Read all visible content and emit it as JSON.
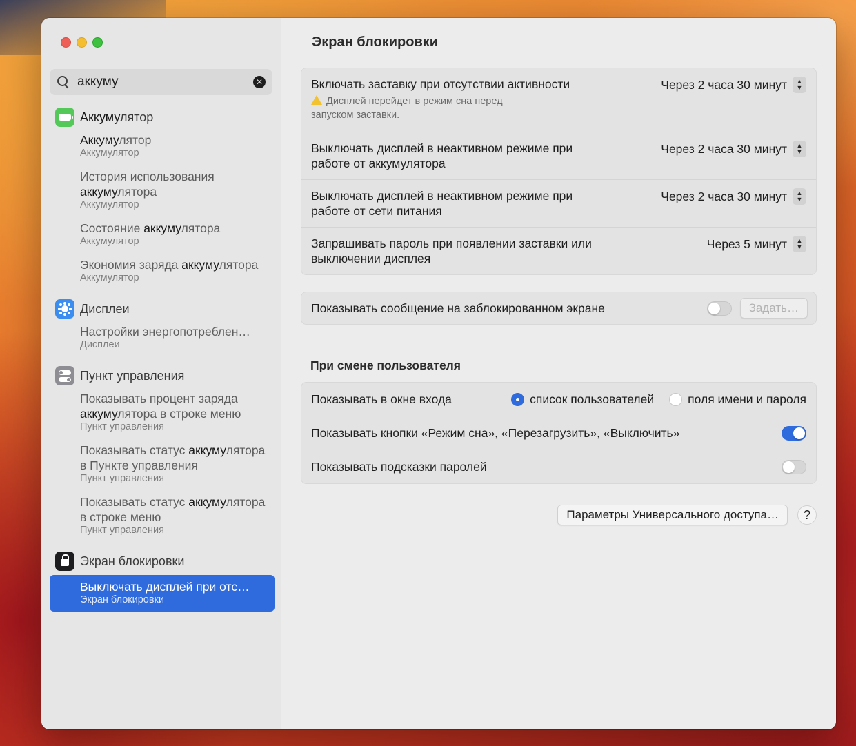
{
  "window": {
    "page_title": "Экран блокировки"
  },
  "search": {
    "value": "аккуму"
  },
  "sidebar": {
    "sections": [
      {
        "title_hl": "Аккуму",
        "title_rest": "лятор",
        "icon": "battery-icon",
        "items": [
          {
            "pre": "",
            "hl": "Аккуму",
            "post": "лятор",
            "sub": "Аккумулятор"
          },
          {
            "pre": "История использования ",
            "hl": "аккуму",
            "post": "лятора",
            "sub": "Аккумулятор"
          },
          {
            "pre": "Состояние ",
            "hl": "аккуму",
            "post": "лятора",
            "sub": "Аккумулятор"
          },
          {
            "pre": "Экономия заряда ",
            "hl": "аккуму",
            "post": "лятора",
            "sub": "Аккумулятор"
          }
        ]
      },
      {
        "title": "Дисплеи",
        "icon": "display-icon",
        "items": [
          {
            "pre": "Настройки энергопотреблен…",
            "hl": "",
            "post": "",
            "sub": "Дисплеи"
          }
        ]
      },
      {
        "title": "Пункт управления",
        "icon": "control-center-icon",
        "items": [
          {
            "pre": "Показывать процент заряда ",
            "hl": "аккуму",
            "post": "лятора в строке меню",
            "sub": "Пункт управления"
          },
          {
            "pre": "Показывать статус ",
            "hl": "аккуму",
            "post": "лятора в Пункте управления",
            "sub": "Пункт управления"
          },
          {
            "pre": "Показывать статус ",
            "hl": "аккуму",
            "post": "лятора в строке меню",
            "sub": "Пункт управления"
          }
        ]
      },
      {
        "title": "Экран блокировки",
        "icon": "lock-screen-icon",
        "items": [
          {
            "pre": "Выключать дисплей при отс…",
            "hl": "",
            "post": "",
            "sub": "Экран блокировки",
            "selected": true
          }
        ]
      }
    ]
  },
  "settings": {
    "screensaver_label": "Включать заставку при отсутствии активности",
    "screensaver_value": "Через 2 часа 30 минут",
    "screensaver_note": "Дисплей перейдет в режим сна перед запуском заставки.",
    "battery_off_label": "Выключать дисплей в неактивном режиме при работе от аккумулятора",
    "battery_off_value": "Через 2 часа 30 минут",
    "power_off_label": "Выключать дисплей в неактивном режиме при работе от сети питания",
    "power_off_value": "Через 2 часа 30 минут",
    "password_label": "Запрашивать пароль при появлении заставки или выключении дисплея",
    "password_value": "Через 5 минут",
    "message_label": "Показывать сообщение на заблокированном экране",
    "message_toggle": false,
    "set_button": "Задать…",
    "user_switch_header": "При смене пользователя",
    "login_window_label": "Показывать в окне входа",
    "radio_users_list": "список пользователей",
    "radio_name_password": "поля имени и пароля",
    "login_selected": "users_list",
    "power_buttons_label": "Показывать кнопки «Режим сна», «Перезагрузить», «Выключить»",
    "power_buttons_toggle": true,
    "hints_label": "Показывать подсказки паролей",
    "hints_toggle": false,
    "accessibility_button": "Параметры Универсального доступа…",
    "help_button": "?"
  },
  "colors": {
    "accent": "#2f6bdc",
    "selection": "#2f6bdc",
    "battery_icon": "#54c95a",
    "display_icon": "#3b8ef0",
    "control_icon": "#8d8d93",
    "lock_icon": "#1d1d1f"
  }
}
